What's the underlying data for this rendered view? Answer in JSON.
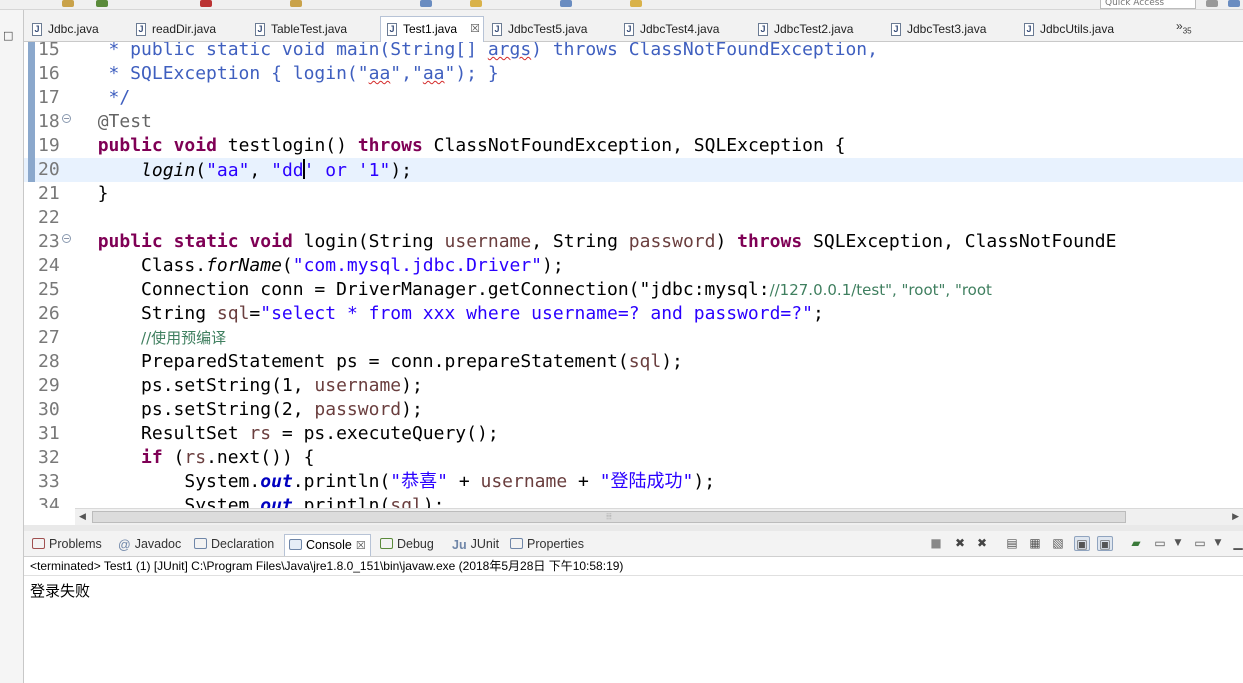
{
  "window": {
    "quick_access_placeholder": "Quick Access"
  },
  "editor_tabs": [
    {
      "label": "Jdbc.java",
      "active": false
    },
    {
      "label": "readDir.java",
      "active": false
    },
    {
      "label": "TableTest.java",
      "active": false
    },
    {
      "label": "Test1.java",
      "active": true
    },
    {
      "label": "JdbcTest5.java",
      "active": false
    },
    {
      "label": "JdbcTest4.java",
      "active": false
    },
    {
      "label": "JdbcTest2.java",
      "active": false
    },
    {
      "label": "JdbcTest3.java",
      "active": false
    },
    {
      "label": "JdbcUtils.java",
      "active": false
    }
  ],
  "tab_overflow": {
    "symbol": "»",
    "count": "35"
  },
  "code_lines": [
    {
      "num": "15",
      "text": "   * public static void main(String[] args) throws ClassNotFoundException,"
    },
    {
      "num": "16",
      "text": "   * SQLException { login(\"aa\",\"aa\"); }"
    },
    {
      "num": "17",
      "text": "   */"
    },
    {
      "num": "18",
      "text": "  @Test"
    },
    {
      "num": "19",
      "text": "  public void testlogin() throws ClassNotFoundException, SQLException {"
    },
    {
      "num": "20",
      "text": "      login(\"aa\", \"dd' or '1\");"
    },
    {
      "num": "21",
      "text": "  }"
    },
    {
      "num": "22",
      "text": ""
    },
    {
      "num": "23",
      "text": "  public static void login(String username, String password) throws SQLException, ClassNotFoundE"
    },
    {
      "num": "24",
      "text": "      Class.forName(\"com.mysql.jdbc.Driver\");"
    },
    {
      "num": "25",
      "text": "      Connection conn = DriverManager.getConnection(\"jdbc:mysql://127.0.0.1/test\", \"root\", \"root"
    },
    {
      "num": "26",
      "text": "      String sql=\"select * from xxx where username=? and password=?\";"
    },
    {
      "num": "27",
      "text": "      //使用预编译"
    },
    {
      "num": "28",
      "text": "      PreparedStatement ps = conn.prepareStatement(sql);"
    },
    {
      "num": "29",
      "text": "      ps.setString(1, username);"
    },
    {
      "num": "30",
      "text": "      ps.setString(2, password);"
    },
    {
      "num": "31",
      "text": "      ResultSet rs = ps.executeQuery();"
    },
    {
      "num": "32",
      "text": "      if (rs.next()) {"
    },
    {
      "num": "33",
      "text": "          System.out.println(\"恭喜\" + username + \"登陆成功\");"
    },
    {
      "num": "34",
      "text": "          System.out.println(sql);"
    }
  ],
  "view_tabs": [
    {
      "label": "Problems",
      "active": false
    },
    {
      "label": "Javadoc",
      "active": false
    },
    {
      "label": "Declaration",
      "active": false
    },
    {
      "label": "Console",
      "active": true
    },
    {
      "label": "Debug",
      "active": false
    },
    {
      "label": "JUnit",
      "active": false
    },
    {
      "label": "Properties",
      "active": false
    }
  ],
  "console": {
    "status": "<terminated> Test1 (1) [JUnit] C:\\Program Files\\Java\\jre1.8.0_151\\bin\\javaw.exe (2018年5月28日 下午10:58:19)",
    "output": [
      "登录失败"
    ]
  },
  "colors": {
    "keyword": "#7f0055",
    "string": "#2a00ff",
    "comment": "#3f7f5f",
    "javadoc": "#3f5fbf",
    "current_line": "#e8f2fe",
    "line_number": "#787878"
  }
}
